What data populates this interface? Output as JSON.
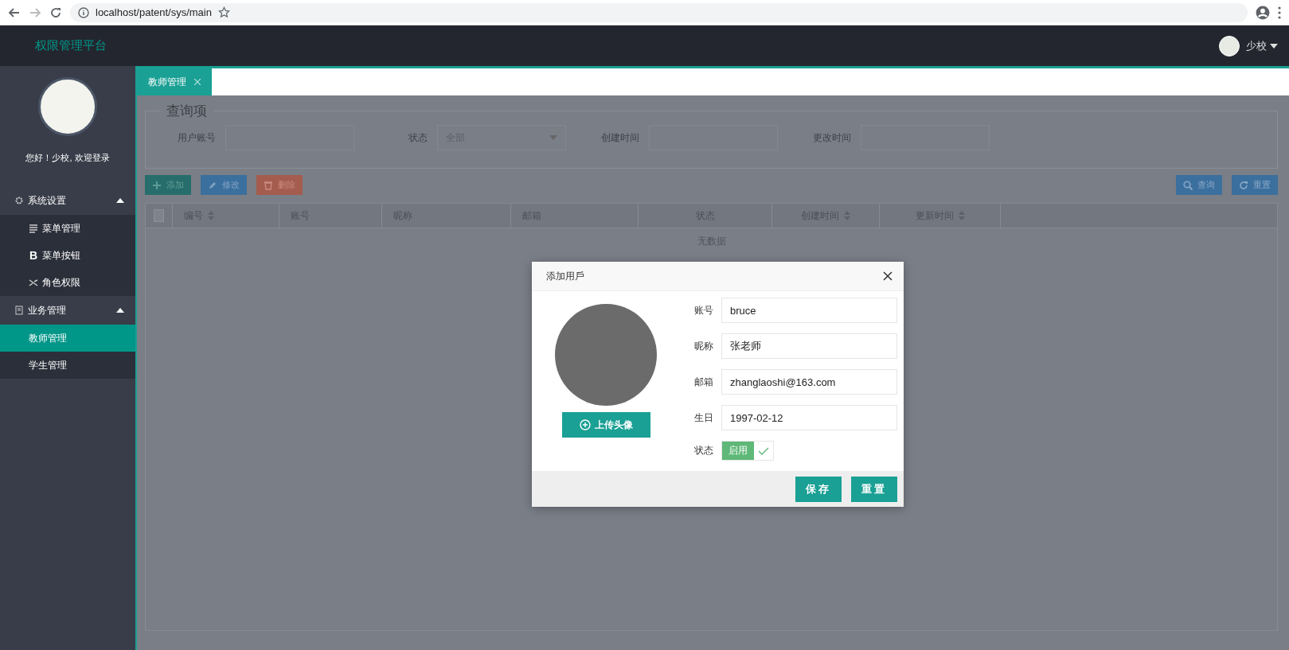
{
  "browser": {
    "url": "localhost/patent/sys/main"
  },
  "header": {
    "app_title": "权限管理平台",
    "user_name": "少校"
  },
  "sidebar": {
    "greeting": "您好！少校, 欢迎登录",
    "groups": [
      {
        "label": "系统设置",
        "expanded": true,
        "items": [
          {
            "label": "菜单管理",
            "selected": false
          },
          {
            "glyph": "B",
            "label": "菜单按钮",
            "selected": false
          },
          {
            "label": "角色权限",
            "selected": false
          }
        ]
      },
      {
        "label": "业务管理",
        "expanded": true,
        "items": [
          {
            "label": "教师管理",
            "selected": true
          },
          {
            "label": "学生管理",
            "selected": false
          }
        ]
      }
    ]
  },
  "tabs": [
    {
      "label": "教师管理",
      "selected": true
    }
  ],
  "query": {
    "legend": "查询项",
    "fields": [
      {
        "label": "用户账号",
        "kind": "input"
      },
      {
        "label": "状态",
        "kind": "select",
        "placeholder": "全部"
      },
      {
        "label": "创建时间",
        "kind": "input"
      },
      {
        "label": "更改时间",
        "kind": "input"
      }
    ]
  },
  "toolbar": {
    "left": [
      {
        "label": "添加",
        "kind": "add"
      },
      {
        "label": "修改",
        "kind": "edit"
      },
      {
        "label": "删除",
        "kind": "delete"
      }
    ],
    "right": [
      {
        "label": "查询",
        "kind": "search"
      },
      {
        "label": "重置",
        "kind": "refresh"
      }
    ]
  },
  "table": {
    "select_all_checked": false,
    "columns": [
      {
        "label": "编号",
        "sortable": true
      },
      {
        "label": "账号",
        "sortable": false
      },
      {
        "label": "昵称",
        "sortable": false
      },
      {
        "label": "邮箱",
        "sortable": false
      },
      {
        "label": "状态",
        "sortable": false
      },
      {
        "label": "创建时间",
        "sortable": true
      },
      {
        "label": "更新时间",
        "sortable": true
      }
    ],
    "empty_text": "无数据"
  },
  "dialog": {
    "title": "添加用戶",
    "upload_label": "上传头像",
    "fields": [
      {
        "label": "账号",
        "value": "bruce"
      },
      {
        "label": "昵称",
        "value": "张老师"
      },
      {
        "label": "邮箱",
        "value": "zhanglaoshi@163.com"
      },
      {
        "label": "生日",
        "value": "1997-02-12"
      }
    ],
    "status": {
      "label": "状态",
      "text": "启用",
      "on": true
    },
    "buttons": [
      {
        "label": "保存"
      },
      {
        "label": "重置"
      }
    ]
  }
}
